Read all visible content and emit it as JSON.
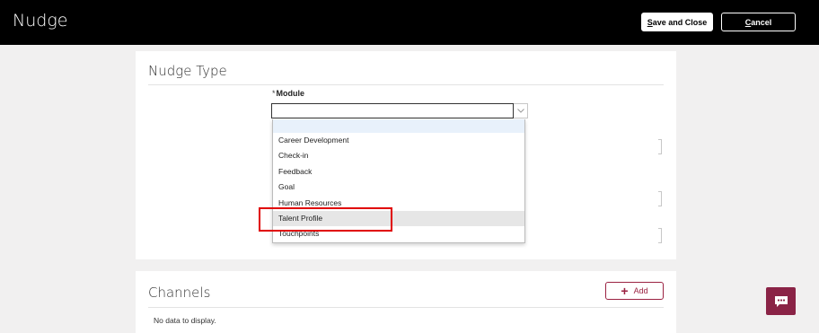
{
  "header": {
    "title": "Nudge",
    "save_close_label": "Save and Close",
    "cancel_label": "Cancel"
  },
  "nudge_type_section": {
    "title": "Nudge Type",
    "module_field": {
      "required_mark": "*",
      "label": "Module",
      "value": "",
      "options": [
        "Career Development",
        "Check-in",
        "Feedback",
        "Goal",
        "Human Resources",
        "Talent Profile",
        "Touchpoints"
      ],
      "hovered_option": "Talent Profile"
    }
  },
  "channels_section": {
    "title": "Channels",
    "add_label": "Add",
    "empty_text": "No data to display."
  },
  "icons": {
    "dropdown": "chevron-down-icon",
    "add": "plus-icon",
    "chat": "chat-bubble-icon"
  },
  "colors": {
    "header_bg": "#000000",
    "accent": "#9b2242",
    "chat_button": "#8a2346",
    "highlight": "#e00000"
  }
}
